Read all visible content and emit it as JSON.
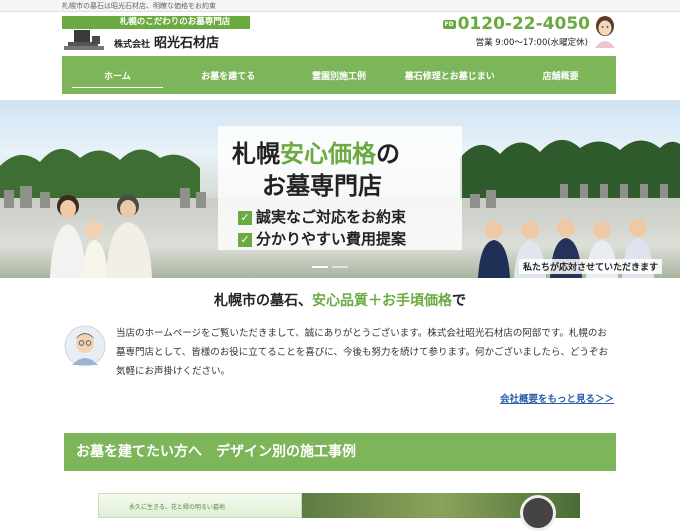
{
  "topbar": {
    "text": "札幌市の墓石は昭光石材店、明瞭な価格をお約束"
  },
  "header": {
    "tagline": "札幌のこだわりのお墓専門店",
    "company_prefix": "株式会社",
    "company_name": "昭光石材店",
    "free_dial_badge": "FD",
    "phone": "0120-22-4050",
    "hours": "営業 9:00〜17:00(水曜定休)"
  },
  "nav": {
    "items": [
      {
        "label": "ホーム"
      },
      {
        "label": "お墓を建てる"
      },
      {
        "label": "霊園別施工例"
      },
      {
        "label": "墓石修理とお墓じまい"
      },
      {
        "label": "店舗概要"
      }
    ]
  },
  "hero": {
    "title_part1": "札幌",
    "title_green": "安心価格",
    "title_part2": "の",
    "title_line2": "お墓専門店",
    "check1": "誠実なご対応をお約束",
    "check2": "分かりやすい費用提案",
    "check_mark": "✓",
    "staff_caption": "私たちが応対させていただきます"
  },
  "catch": {
    "part1": "札幌市の墓石、",
    "green": "安心品質＋お手頃価格",
    "part2": "で"
  },
  "intro": {
    "text": "当店のホームページをご覧いただきまして、誠にありがとうございます。株式会社昭光石材店の阿部です。札幌のお墓専門店として、皆様のお役に立てることを喜びに、今後も努力を続けて参ります。何かございましたら、どうぞお気軽にお声掛けください。",
    "more_link": "会社概要をもっと見る＞＞"
  },
  "section": {
    "title": "お墓を建てたい方へ　デザイン別の施工事例"
  },
  "bottom": {
    "banner_text": "永久に生きる、花と緑の明るい墓地"
  },
  "colors": {
    "accent": "#7cb55a",
    "brand_green": "#6aaa40",
    "link": "#2a5ea8"
  }
}
